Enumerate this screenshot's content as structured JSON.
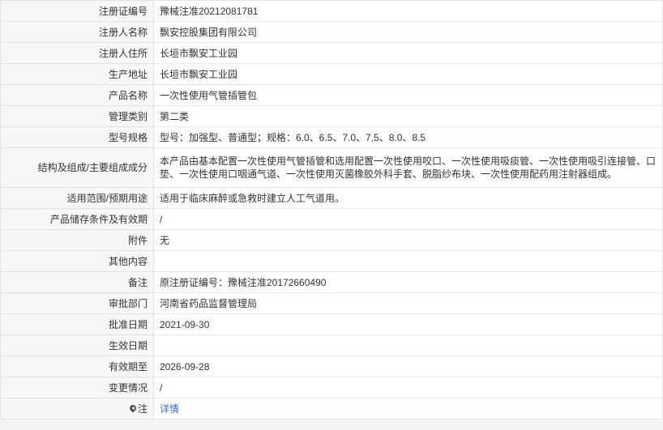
{
  "rows": [
    {
      "label": "注册证编号",
      "value": "豫械注准20212081781"
    },
    {
      "label": "注册人名称",
      "value": "飘安控股集团有限公司"
    },
    {
      "label": "注册人住所",
      "value": "长垣市飘安工业园"
    },
    {
      "label": "生产地址",
      "value": "长垣市飘安工业园"
    },
    {
      "label": "产品名称",
      "value": "一次性使用气管插管包"
    },
    {
      "label": "管理类别",
      "value": "第二类"
    },
    {
      "label": "型号规格",
      "value": "型号：加强型、普通型；规格：6.0、6.5、7.0、7.5、8.0、8.5"
    },
    {
      "label": "结构及组成/主要组成成分",
      "value": "本产品由基本配置一次性使用气管插管和选用配置一次性使用咬口、一次性使用吸痰管、一次性使用吸引连接管、口垫、一次性使用口咽通气道、一次性使用灭菌橡胶外科手套、脱脂纱布块、一次性使用配药用注射器组成。"
    },
    {
      "label": "适用范围/预期用途",
      "value": "适用于临床麻醉或急救时建立人工气道用。"
    },
    {
      "label": "产品储存条件及有效期",
      "value": "/"
    },
    {
      "label": "附件",
      "value": "无"
    },
    {
      "label": "其他内容",
      "value": ""
    },
    {
      "label": "备注",
      "value": "原注册证编号：豫械注准20172660490"
    },
    {
      "label": "审批部门",
      "value": "河南省药品监督管理局"
    },
    {
      "label": "批准日期",
      "value": "2021-09-30"
    },
    {
      "label": "生效日期",
      "value": ""
    },
    {
      "label": "有效期至",
      "value": "2026-09-28"
    },
    {
      "label": "变更情况",
      "value": "/"
    }
  ],
  "note": {
    "icon": "map-pin-icon",
    "label": "注",
    "link_text": "详情"
  },
  "colors": {
    "label_bg": "#f7f7f7",
    "border": "#e3e3e3",
    "link": "#2f6ccf"
  }
}
